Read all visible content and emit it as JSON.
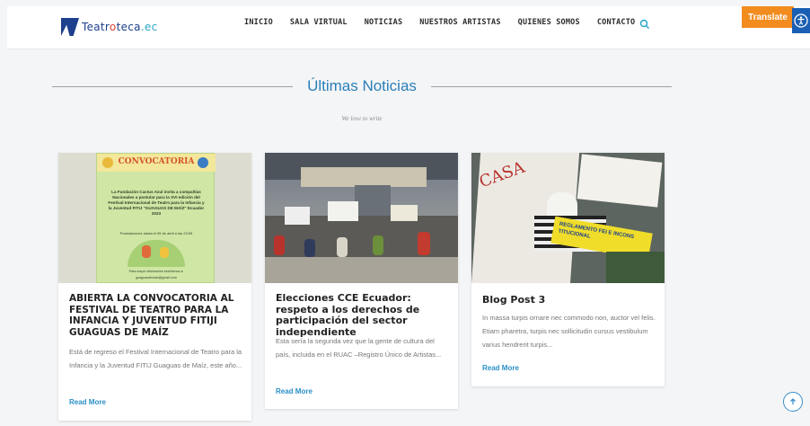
{
  "header": {
    "logo": {
      "part1": "Teatr",
      "accent": "o",
      "part2": "teca",
      "accent2": ".ec"
    },
    "nav": [
      "INICIO",
      "SALA VIRTUAL",
      "NOTICIAS",
      "NUESTROS ARTISTAS",
      "QUIENES SOMOS",
      "CONTACTO"
    ],
    "translate_label": "Translate"
  },
  "section": {
    "title": "Últimas Noticias",
    "subtitle": "We love to write"
  },
  "posts": [
    {
      "title": "ABIERTA LA CONVOCATORIA AL FESTIVAL DE TEATRO PARA LA INFANCIA Y JUVENTUD FITIJI GUAGUAS DE MAÍZ",
      "excerpt": "Está de regreso el Festival Internacional de Teatro para la Infancia y la Juventud FITIJ Guaguas de Maíz, este año...",
      "read_more": "Read More",
      "poster": {
        "heading": "CONVOCATORIA",
        "body": "La Fundación Cactus Azul invita a compañías Nacionales a postular para la XVI edición del Festival Internacional de Teatro para la Infancia y la Juventud FITIJ \"GUAGUAS DE MAÍZ\" Ecuador 2023",
        "deadline": "Postulaciones hasta el 05 de abril a las 23:59",
        "footer": "Para mayor información escríbenos a:",
        "email": "guaguasdemaiz@gmail.com"
      }
    },
    {
      "title": "Elecciones CCE Ecuador: respeto a los derechos de participación del sector independiente",
      "excerpt": "Esta sería la segunda vez que la gente de cultura del país, incluida en el RUAC –Registro Único de Artistas...",
      "read_more": "Read More"
    },
    {
      "title": "Blog Post 3",
      "excerpt": "In massa turpis ornare nec commodo non, auctor vel felis. Etiam pharetra, turpis nec sollicitudin cursus vestibulum varius hendrerit turpis...",
      "read_more": "Read More",
      "sign": {
        "left": "CASA",
        "banner": "REGLAMENTO FEI E INCONS TITUCIONAL"
      }
    }
  ]
}
